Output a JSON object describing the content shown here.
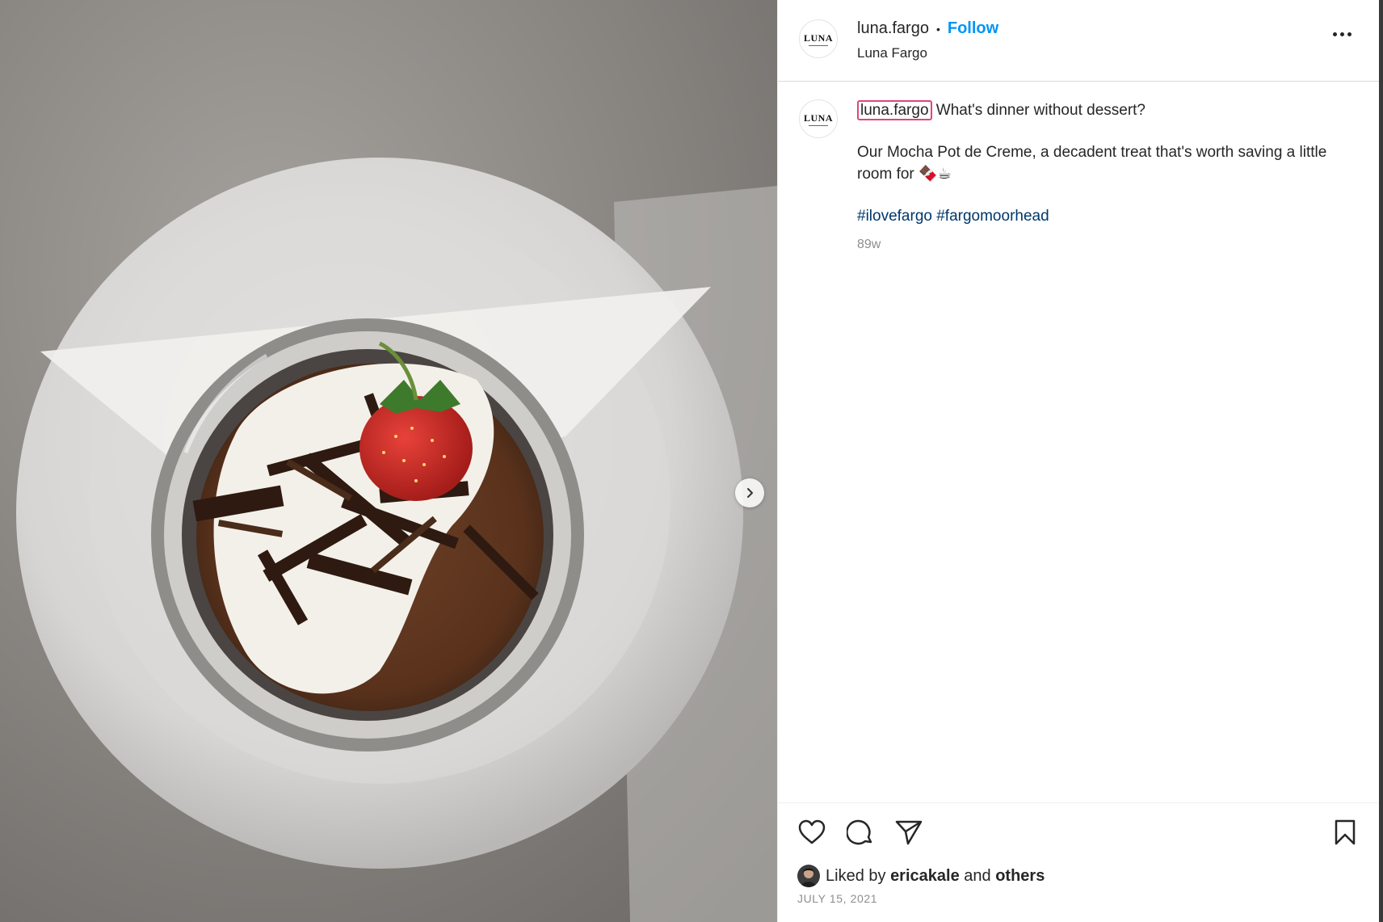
{
  "header": {
    "username": "luna.fargo",
    "separator": "•",
    "follow_label": "Follow",
    "display_name": "Luna Fargo",
    "avatar_text": "LUNA",
    "more_icon": "more-horizontal-icon"
  },
  "caption": {
    "username": "luna.fargo",
    "headline": "What's dinner without dessert?",
    "body": "Our Mocha Pot de Creme, a decadent treat that's worth saving a little room for 🍫☕",
    "hashtags": [
      "#ilovefargo",
      "#fargomoorhead"
    ],
    "age": "89w"
  },
  "actions": {
    "like_icon": "heart-icon",
    "comment_icon": "comment-icon",
    "share_icon": "send-icon",
    "save_icon": "bookmark-icon"
  },
  "likes": {
    "prefix": "Liked by",
    "user": "ericakale",
    "and": "and",
    "others": "others"
  },
  "date": "JULY 15, 2021",
  "media": {
    "next_icon": "chevron-right-icon",
    "description": "Mocha pot de creme topped with whipped cream, chocolate shavings and a strawberry"
  },
  "colors": {
    "follow": "#0095f6",
    "hashtag": "#00376b",
    "secondary_text": "#8e8e8e",
    "mention_highlight": "#e0457b"
  }
}
